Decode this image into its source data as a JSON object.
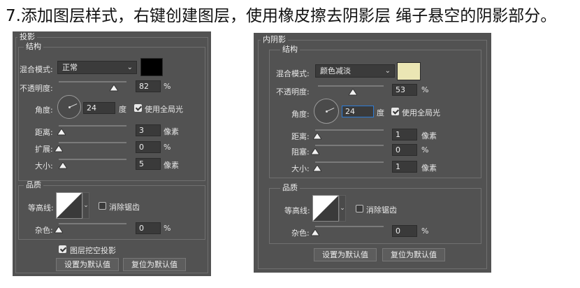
{
  "caption": "7.添加图层样式，右键创建图层，使用橡皮擦去阴影层 绳子悬空的阴影部分。",
  "left_panel": {
    "title": "投影",
    "structure_title": "结构",
    "blend_mode_label": "混合模式:",
    "blend_mode_value": "正常",
    "color": "#000000",
    "opacity_label": "不透明度:",
    "opacity_value": "82",
    "opacity_unit": "%",
    "opacity_fraction": 0.82,
    "angle_label": "角度:",
    "angle_value": "24",
    "angle_unit": "度",
    "global_light_label": "使用全局光",
    "distance_label": "距离:",
    "distance_value": "3",
    "distance_unit": "像素",
    "spread_label": "扩展:",
    "spread_value": "0",
    "spread_unit": "%",
    "size_label": "大小:",
    "size_value": "5",
    "size_unit": "像素",
    "quality_title": "品质",
    "contour_label": "等高线:",
    "antialias_label": "消除锯齿",
    "noise_label": "杂色:",
    "noise_value": "0",
    "noise_unit": "%",
    "knockout_label": "图层挖空投影",
    "make_default_label": "设置为默认值",
    "reset_default_label": "复位为默认值"
  },
  "right_panel": {
    "title": "内阴影",
    "structure_title": "结构",
    "blend_mode_label": "混合模式:",
    "blend_mode_value": "颜色减淡",
    "color": "#ebe6b4",
    "opacity_label": "不透明度:",
    "opacity_value": "53",
    "opacity_unit": "%",
    "opacity_fraction": 0.53,
    "angle_label": "角度:",
    "angle_value": "24",
    "angle_unit": "度",
    "global_light_label": "使用全局光",
    "distance_label": "距离:",
    "distance_value": "1",
    "distance_unit": "像素",
    "choke_label": "阻塞:",
    "choke_value": "0",
    "choke_unit": "%",
    "size_label": "大小:",
    "size_value": "1",
    "size_unit": "像素",
    "quality_title": "品质",
    "contour_label": "等高线:",
    "antialias_label": "消除锯齿",
    "noise_label": "杂色:",
    "noise_value": "0",
    "noise_unit": "%",
    "make_default_label": "设置为默认值",
    "reset_default_label": "复位为默认值"
  },
  "icons": {
    "dropdown": "chevron-down-icon",
    "slider_thumb": "triangle-thumb-icon",
    "angle_dial": "angle-dial-icon",
    "contour": "contour-curve-icon"
  }
}
